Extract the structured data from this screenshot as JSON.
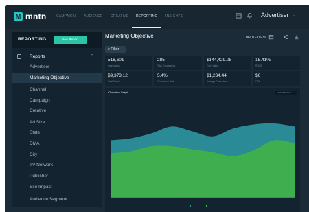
{
  "app": {
    "logo_text": "mntn",
    "logo_mark": "M"
  },
  "nav": {
    "tabs": [
      {
        "label": "CAMPAIGN"
      },
      {
        "label": "AUDIENCE"
      },
      {
        "label": "CREATIVE"
      },
      {
        "label": "REPORTING"
      },
      {
        "label": "INSIGHTS"
      }
    ],
    "active_tab": "REPORTING",
    "account_label": "Advertiser"
  },
  "sidebar": {
    "title": "REPORTING",
    "new_report_label": "New Report",
    "section_label": "Reports",
    "items": [
      {
        "label": "Advertiser"
      },
      {
        "label": "Marketing Objective"
      },
      {
        "label": "Channel"
      },
      {
        "label": "Campaign"
      },
      {
        "label": "Creative"
      },
      {
        "label": "Ad Size"
      },
      {
        "label": "State"
      },
      {
        "label": "DMA"
      },
      {
        "label": "City"
      },
      {
        "label": "TV Network"
      },
      {
        "label": "Publisher"
      },
      {
        "label": "Site Impact"
      },
      {
        "label": "Audience Segment"
      }
    ],
    "active_item": "Marketing Objective"
  },
  "main": {
    "title": "Marketing Objective",
    "date_range": "06/01 - 06/30",
    "filter_label": "Filter",
    "metrics": [
      {
        "value": "516,601",
        "label": "Impressions"
      },
      {
        "value": "285",
        "label": "Total Conversions"
      },
      {
        "value": "$144,429.08",
        "label": "Conv Value"
      },
      {
        "value": "15.41%",
        "label": "ROAS"
      },
      {
        "value": "$9,373.12",
        "label": "Total Spend"
      },
      {
        "value": "5.4%",
        "label": "Conversion Rate"
      },
      {
        "value": "$1,234.44",
        "label": "Average Order Value"
      },
      {
        "value": "$6",
        "label": "CPA"
      }
    ]
  },
  "chart": {
    "title": "Overview Graph",
    "select_label": "Select Metrics",
    "colors": {
      "teal": "#2a8a96",
      "green": "#3fae4f",
      "bg": "#142330"
    }
  },
  "chart_data": {
    "type": "area",
    "x": [
      1,
      2,
      3,
      4,
      5,
      6,
      7,
      8,
      9,
      10
    ],
    "series": [
      {
        "values": [
          58,
          60,
          65,
          72,
          67,
          62,
          70,
          74,
          75,
          72
        ]
      },
      {
        "values": [
          45,
          47,
          52,
          52,
          49,
          46,
          42,
          48,
          58,
          55
        ]
      }
    ]
  }
}
